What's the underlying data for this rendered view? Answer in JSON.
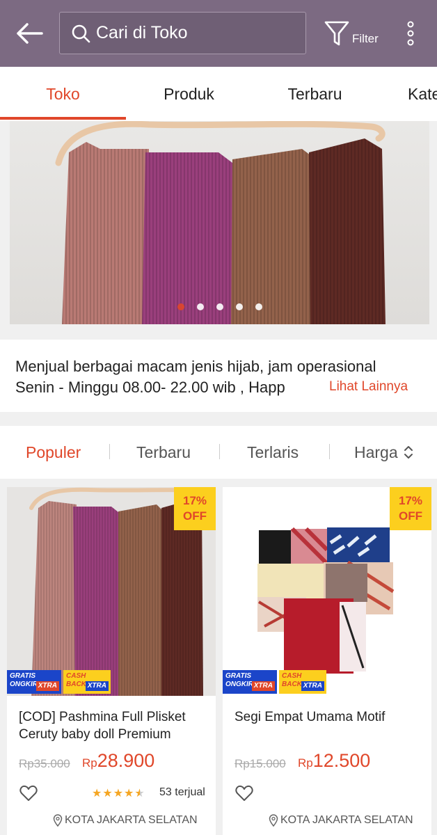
{
  "header": {
    "search_placeholder": "Cari di Toko",
    "filter_label": "Filter"
  },
  "tabs": [
    {
      "label": "Toko",
      "active": true
    },
    {
      "label": "Produk"
    },
    {
      "label": "Terbaru"
    },
    {
      "label": "Kategori"
    }
  ],
  "banner": {
    "slide_count": 5,
    "active_slide": 1
  },
  "description": {
    "line1": "Menjual berbagai macam jenis hijab, jam operasional",
    "line2": "Senin - Minggu  08.00- 22.00 wib , Happ",
    "see_more": "Lihat Lainnya"
  },
  "sort": {
    "options": [
      {
        "label": "Populer",
        "active": true
      },
      {
        "label": "Terbaru"
      },
      {
        "label": "Terlaris"
      },
      {
        "label": "Harga"
      }
    ]
  },
  "products": [
    {
      "discount_pct": "17%",
      "discount_off": "OFF",
      "promo1_top": "GRATIS",
      "promo1_bottom": "ONGKIR",
      "promo2_top": "CASH",
      "promo2_bottom": "BACK",
      "xtra": "XTRA",
      "title": "[COD] Pashmina Full Plisket Ceruty baby doll Premium",
      "original_price": "Rp35.000",
      "currency": "Rp",
      "price": "28.900",
      "rating": 4.5,
      "sold": "53 terjual",
      "location": "KOTA JAKARTA SELATAN"
    },
    {
      "discount_pct": "17%",
      "discount_off": "OFF",
      "promo1_top": "GRATIS",
      "promo1_bottom": "ONGKIR",
      "promo2_top": "CASH",
      "promo2_bottom": "BACK",
      "xtra": "XTRA",
      "title": "Segi Empat Umama Motif",
      "original_price": "Rp15.000",
      "currency": "Rp",
      "price": "12.500",
      "location": "KOTA JAKARTA SELATAN"
    }
  ],
  "colors": {
    "header_bg": "#7c6a82",
    "accent": "#e0472a",
    "badge_yellow": "#fccf1e",
    "promo_blue": "#1b45c9"
  }
}
